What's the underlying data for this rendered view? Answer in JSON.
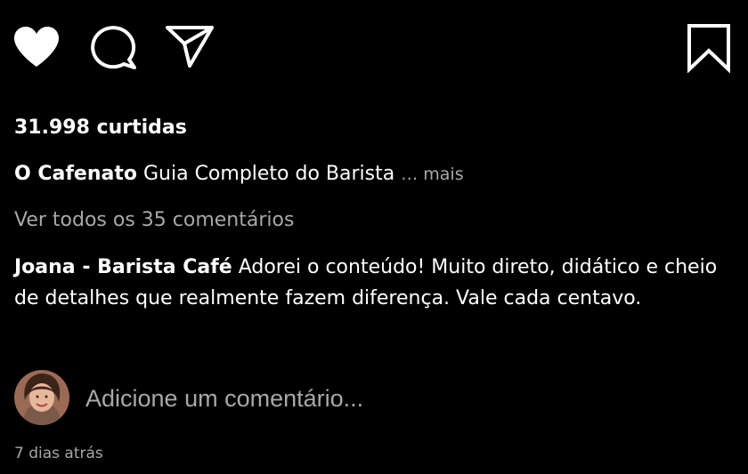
{
  "actions": {
    "like_icon": "heart-icon",
    "comment_icon": "speech-bubble-icon",
    "share_icon": "paper-plane-icon",
    "save_icon": "bookmark-icon"
  },
  "post": {
    "likes_text": "31.998 curtidas",
    "caption_author": "O Cafenato",
    "caption_text": "Guia Completo do Barista",
    "caption_more": "… mais",
    "view_comments": "Ver todos os 35 comentários",
    "timestamp": "7 dias atrás"
  },
  "comment": {
    "author": "Joana - Barista Café",
    "text": "Adorei o conteúdo! Muito direto, didático e cheio de detalhes que realmente fazem diferença. Vale cada centavo."
  },
  "add_comment": {
    "placeholder": "Adicione um comentário..."
  },
  "colors": {
    "background": "#000000",
    "text": "#ffffff",
    "muted": "#a8a8a8"
  }
}
